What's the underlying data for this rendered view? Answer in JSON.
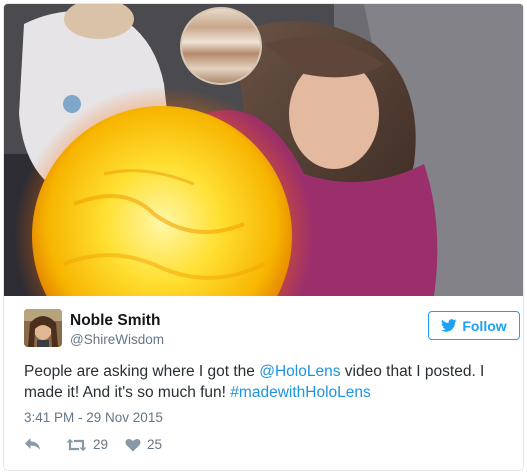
{
  "tweet": {
    "author_name": "Noble Smith",
    "author_handle": "@ShireWisdom",
    "follow_label": "Follow",
    "text_before_mention": "People are asking where I got the ",
    "mention": "@HoloLens",
    "text_after_mention": " video that I posted. I made it! And it's so much fun! ",
    "hashtag": "#madewithHoloLens",
    "timestamp": "3:41 PM - 29 Nov 2015",
    "retweet_count": "29",
    "like_count": "25"
  },
  "icons": {
    "follow": "twitter-bird-icon",
    "reply": "reply-arrow-icon",
    "retweet": "retweet-icon",
    "like": "heart-icon"
  },
  "colors": {
    "accent": "#1da1f2",
    "link": "#1b95e0",
    "muted": "#657786",
    "text": "#292f33"
  }
}
